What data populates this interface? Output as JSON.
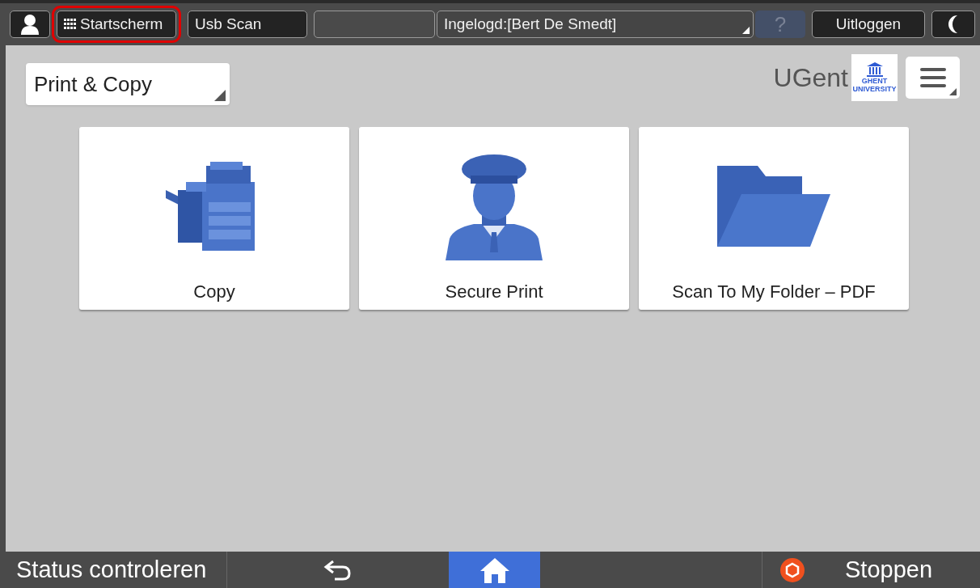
{
  "top_bar": {
    "buttons": [
      {
        "kind": "user"
      },
      {
        "kind": "text",
        "label": "Startscherm",
        "grid_icon": true,
        "highlighted": true
      },
      {
        "kind": "text",
        "label": "Usb Scan",
        "grid_icon": false,
        "highlighted": false
      },
      {
        "kind": "blank"
      },
      {
        "kind": "dropdown",
        "label": "Ingelogd:[Bert De Smedt]"
      },
      {
        "kind": "help",
        "label": "?",
        "disabled": true
      },
      {
        "kind": "text",
        "label": "Uitloggen",
        "grid_icon": false,
        "highlighted": false,
        "centered": true
      },
      {
        "kind": "moon"
      }
    ]
  },
  "category_select": {
    "value": "Print & Copy"
  },
  "brand": {
    "name": "UGent",
    "logo_lines": [
      "GHENT",
      "UNIVERSITY"
    ]
  },
  "tiles": [
    {
      "kind": "copier",
      "label": "Copy"
    },
    {
      "kind": "officer",
      "label": "Secure Print"
    },
    {
      "kind": "folder",
      "label": "Scan To My Folder – PDF"
    }
  ],
  "bottom_bar": {
    "status": "Status controleren",
    "home_selected": true,
    "stop": "Stoppen"
  }
}
